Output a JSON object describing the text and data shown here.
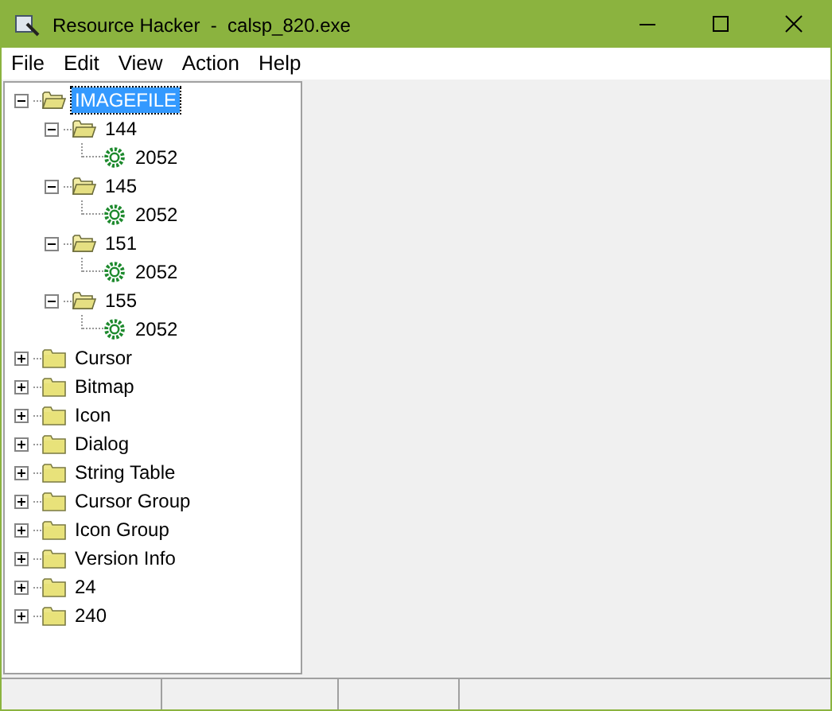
{
  "window": {
    "title": "Resource Hacker  -  calsp_820.exe"
  },
  "menu": [
    "File",
    "Edit",
    "View",
    "Action",
    "Help"
  ],
  "tree": [
    {
      "label": "IMAGEFILE",
      "kind": "folder",
      "expanded": true,
      "selected": true,
      "children": [
        {
          "label": "144",
          "kind": "folder",
          "expanded": true,
          "selected": false,
          "children": [
            {
              "label": "2052",
              "kind": "resource",
              "selected": false
            }
          ]
        },
        {
          "label": "145",
          "kind": "folder",
          "expanded": true,
          "selected": false,
          "children": [
            {
              "label": "2052",
              "kind": "resource",
              "selected": false
            }
          ]
        },
        {
          "label": "151",
          "kind": "folder",
          "expanded": true,
          "selected": false,
          "children": [
            {
              "label": "2052",
              "kind": "resource",
              "selected": false
            }
          ]
        },
        {
          "label": "155",
          "kind": "folder",
          "expanded": true,
          "selected": false,
          "children": [
            {
              "label": "2052",
              "kind": "resource",
              "selected": false
            }
          ]
        }
      ]
    },
    {
      "label": "Cursor",
      "kind": "folder",
      "expanded": false,
      "selected": false
    },
    {
      "label": "Bitmap",
      "kind": "folder",
      "expanded": false,
      "selected": false
    },
    {
      "label": "Icon",
      "kind": "folder",
      "expanded": false,
      "selected": false
    },
    {
      "label": "Dialog",
      "kind": "folder",
      "expanded": false,
      "selected": false
    },
    {
      "label": "String Table",
      "kind": "folder",
      "expanded": false,
      "selected": false
    },
    {
      "label": "Cursor Group",
      "kind": "folder",
      "expanded": false,
      "selected": false
    },
    {
      "label": "Icon Group",
      "kind": "folder",
      "expanded": false,
      "selected": false
    },
    {
      "label": "Version Info",
      "kind": "folder",
      "expanded": false,
      "selected": false
    },
    {
      "label": "24",
      "kind": "folder",
      "expanded": false,
      "selected": false
    },
    {
      "label": "240",
      "kind": "folder",
      "expanded": false,
      "selected": false
    }
  ]
}
